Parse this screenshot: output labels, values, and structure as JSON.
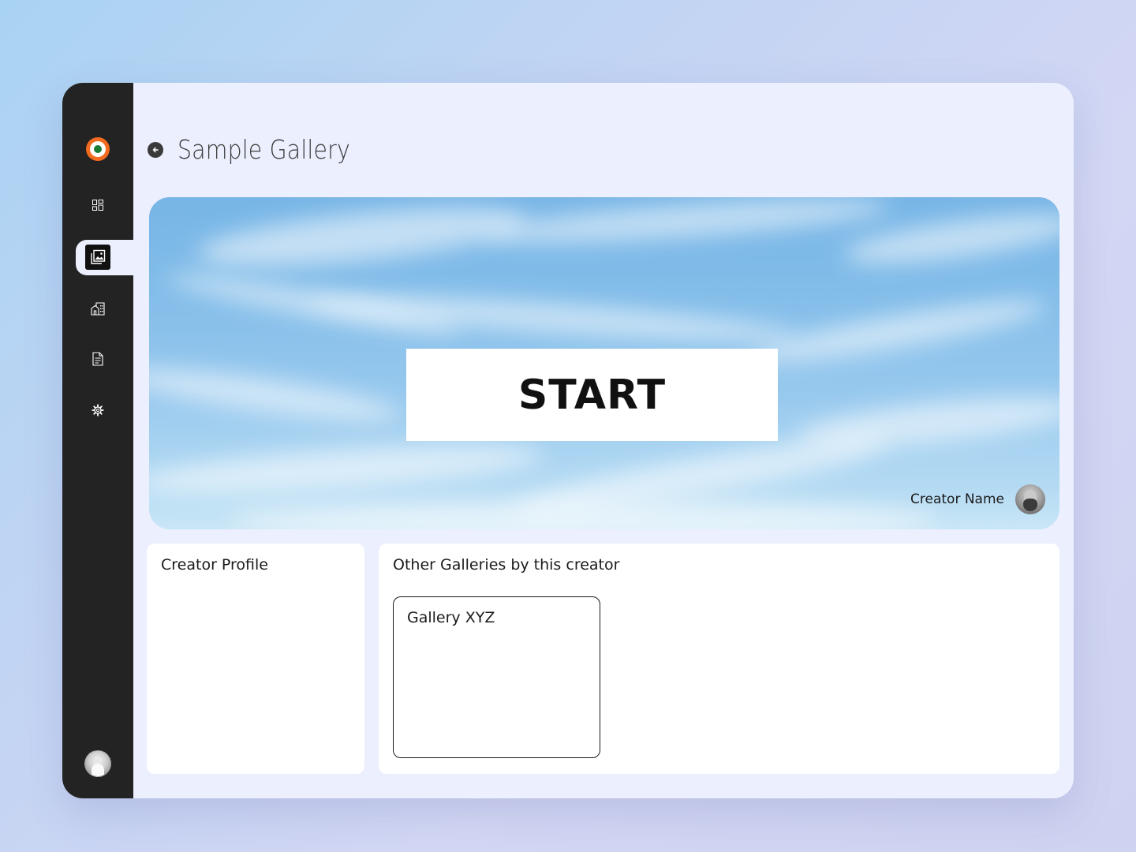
{
  "page": {
    "title": "Sample Gallery"
  },
  "sidebar": {
    "logo": "brand-logo",
    "items": [
      {
        "name": "dashboard",
        "icon": "grid-icon",
        "active": false
      },
      {
        "name": "gallery",
        "icon": "image-gallery-icon",
        "active": true
      },
      {
        "name": "venues",
        "icon": "building-icon",
        "active": false
      },
      {
        "name": "documents",
        "icon": "document-icon",
        "active": false
      },
      {
        "name": "settings",
        "icon": "gear-icon",
        "active": false
      }
    ],
    "user_avatar": "user-avatar"
  },
  "hero": {
    "start_label": "START",
    "creator_name": "Creator Name"
  },
  "profile_card": {
    "title": "Creator Profile"
  },
  "galleries_card": {
    "title": "Other Galleries by this creator",
    "items": [
      {
        "name": "Gallery XYZ"
      }
    ]
  },
  "colors": {
    "brand_orange": "#f26b1f",
    "brand_green": "#1b7a35",
    "sidebar_bg": "#232323",
    "content_bg": "#ebeffe"
  }
}
